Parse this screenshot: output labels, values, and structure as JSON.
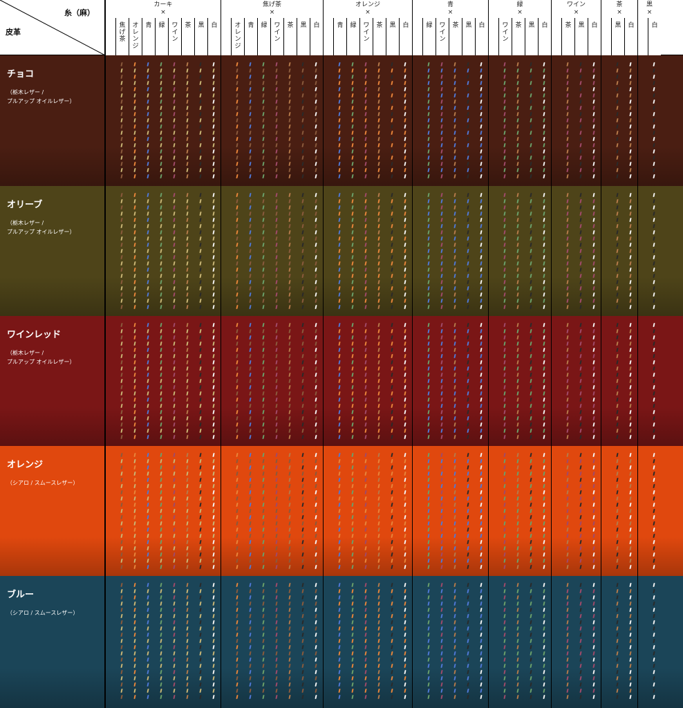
{
  "corner": {
    "thread_label": "糸（麻）",
    "leather_label": "皮革"
  },
  "thread_colors": {
    "カーキ": "#c9b675",
    "焦げ茶": "#8a5a3c",
    "オレンジ": "#e8853a",
    "青": "#4f78d6",
    "緑": "#6aa06a",
    "ワイン": "#a04a6a",
    "茶": "#b57a4a",
    "黒": "#2a2a2a",
    "白": "#f4f4f4"
  },
  "groups": [
    {
      "top": "カーキ",
      "cross": "×",
      "needle_color": "カーキ",
      "columns": [
        "焦げ茶",
        "オレンジ",
        "青",
        "緑",
        "ワイン",
        "茶",
        "黒",
        "白"
      ]
    },
    {
      "top": "焦げ茶",
      "cross": "×",
      "needle_color": "焦げ茶",
      "columns": [
        "オレンジ",
        "青",
        "緑",
        "ワイン",
        "茶",
        "黒",
        "白"
      ]
    },
    {
      "top": "オレンジ",
      "cross": "×",
      "needle_color": "オレンジ",
      "columns": [
        "青",
        "緑",
        "ワイン",
        "茶",
        "黒",
        "白"
      ]
    },
    {
      "top": "青",
      "cross": "×",
      "needle_color": "青",
      "columns": [
        "緑",
        "ワイン",
        "茶",
        "黒",
        "白"
      ]
    },
    {
      "top": "緑",
      "cross": "×",
      "needle_color": "緑",
      "columns": [
        "ワイン",
        "茶",
        "黒",
        "白"
      ]
    },
    {
      "top": "ワイン",
      "cross": "×",
      "needle_color": "ワイン",
      "columns": [
        "茶",
        "黒",
        "白"
      ]
    },
    {
      "top": "茶",
      "cross": "×",
      "needle_color": "茶",
      "columns": [
        "黒",
        "白"
      ]
    },
    {
      "top": "黒",
      "cross": "×",
      "needle_color": "黒",
      "columns": [
        "白"
      ]
    }
  ],
  "leathers": [
    {
      "name": "チョコ",
      "sub": "（栃木レザー /\nプルアップ オイルレザー）",
      "color": "#4a1e12"
    },
    {
      "name": "オリーブ",
      "sub": "（栃木レザー /\nプルアップ オイルレザー）",
      "color": "#4e4419"
    },
    {
      "name": "ワインレッド",
      "sub": "（栃木レザー /\nプルアップ オイルレザー）",
      "color": "#7a1616"
    },
    {
      "name": "オレンジ",
      "sub": "（シアロ / スムースレザー）",
      "color": "#e0480e"
    },
    {
      "name": "ブルー",
      "sub": "（シアロ / スムースレザー）",
      "color": "#1b4558"
    }
  ]
}
